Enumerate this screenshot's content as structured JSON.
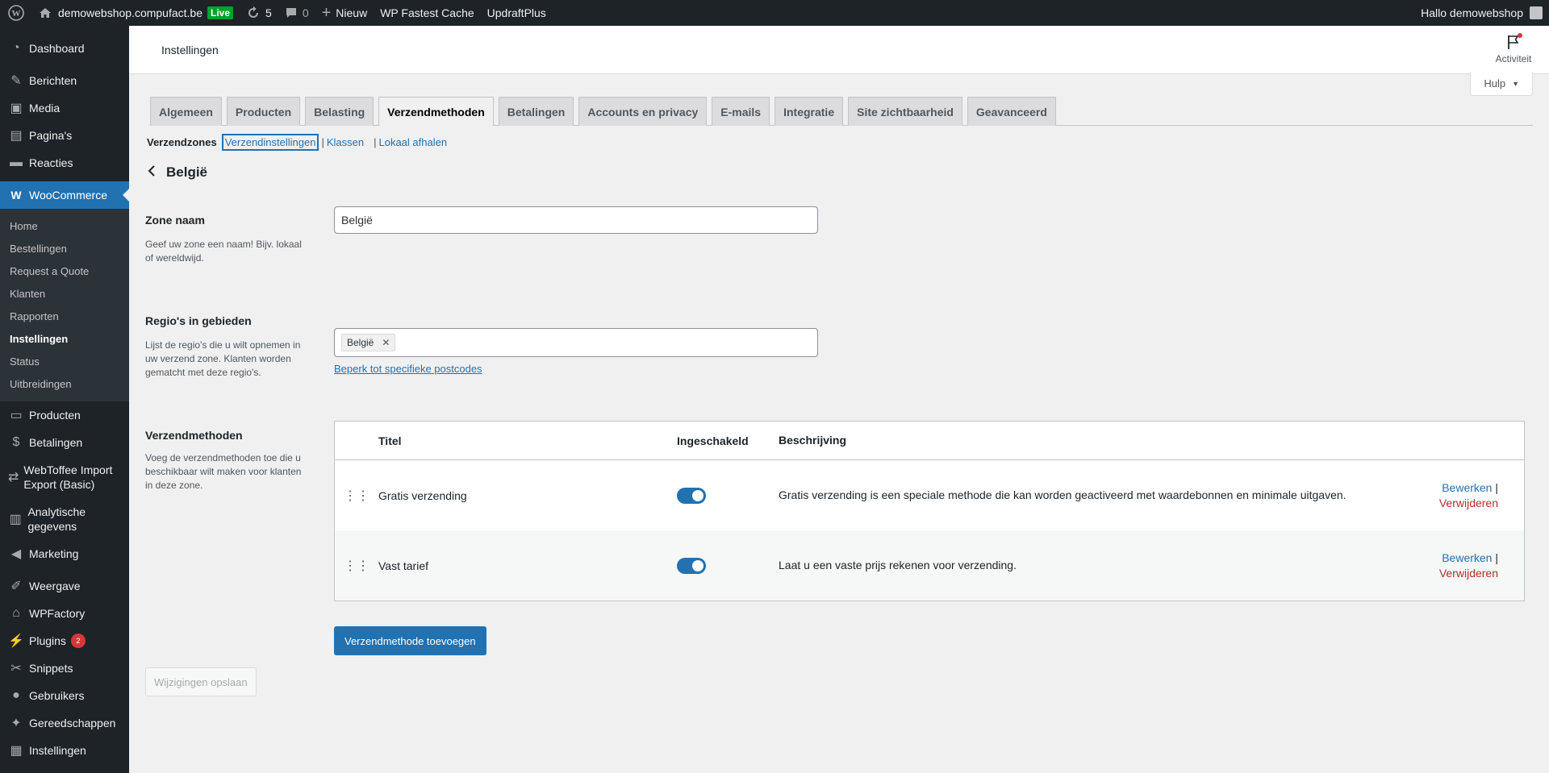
{
  "adminbar": {
    "site_name": "demowebshop.compufact.be",
    "live_label": "Live",
    "updates_count": "5",
    "comments_count": "0",
    "new_label": "Nieuw",
    "fastest_cache": "WP Fastest Cache",
    "updraft": "UpdraftPlus",
    "greeting": "Hallo demowebshop"
  },
  "sidebar": {
    "dashboard": "Dashboard",
    "berichten": "Berichten",
    "media": "Media",
    "paginas": "Pagina's",
    "reacties": "Reacties",
    "woocommerce": "WooCommerce",
    "submenu": [
      "Home",
      "Bestellingen",
      "Request a Quote",
      "Klanten",
      "Rapporten",
      "Instellingen",
      "Status",
      "Uitbreidingen"
    ],
    "producten": "Producten",
    "betalingen": "Betalingen",
    "webtoffee": "WebToffee Import Export (Basic)",
    "analytische": "Analytische gegevens",
    "marketing": "Marketing",
    "weergave": "Weergave",
    "wpfactory": "WPFactory",
    "plugins": "Plugins",
    "plugins_badge": "2",
    "snippets": "Snippets",
    "gebruikers": "Gebruikers",
    "gereedschappen": "Gereedschappen",
    "instellingen": "Instellingen"
  },
  "header": {
    "title": "Instellingen",
    "activity": "Activiteit",
    "help": "Hulp"
  },
  "tabs": [
    "Algemeen",
    "Producten",
    "Belasting",
    "Verzendmethoden",
    "Betalingen",
    "Accounts en privacy",
    "E-mails",
    "Integratie",
    "Site zichtbaarheid",
    "Geavanceerd"
  ],
  "subnav": {
    "current": "Verzendzones",
    "links": [
      "Verzendinstellingen",
      "Klassen",
      "Lokaal afhalen"
    ]
  },
  "zone": {
    "heading": "België",
    "name_label": "Zone naam",
    "name_desc": "Geef uw zone een naam! Bijv. lokaal of wereldwijd.",
    "name_value": "België",
    "regions_label": "Regio's in gebieden",
    "regions_desc": "Lijst de regio's die u wilt opnemen in uw verzend zone. Klanten worden gematcht met deze regio's.",
    "region_tag": "België",
    "limit_link": "Beperk tot specifieke postcodes",
    "methods_label": "Verzendmethoden",
    "methods_desc": "Voeg de verzendmethoden toe die u beschikbaar wilt maken voor klanten in deze zone."
  },
  "methods_table": {
    "headers": [
      "Titel",
      "Ingeschakeld",
      "Beschrijving"
    ],
    "rows": [
      {
        "title": "Gratis verzending",
        "enabled": true,
        "description": "Gratis verzending is een speciale methode die kan worden geactiveerd met waardebonnen en minimale uitgaven.",
        "edit": "Bewerken",
        "delete": "Verwijderen"
      },
      {
        "title": "Vast tarief",
        "enabled": true,
        "description": "Laat u een vaste prijs rekenen voor verzending.",
        "edit": "Bewerken",
        "delete": "Verwijderen"
      }
    ]
  },
  "buttons": {
    "add_method": "Verzendmethode toevoegen",
    "save": "Wijzigingen opslaan"
  },
  "colors": {
    "primary": "#2271b1",
    "adminbar": "#1d2327",
    "danger": "#b32d2e"
  }
}
